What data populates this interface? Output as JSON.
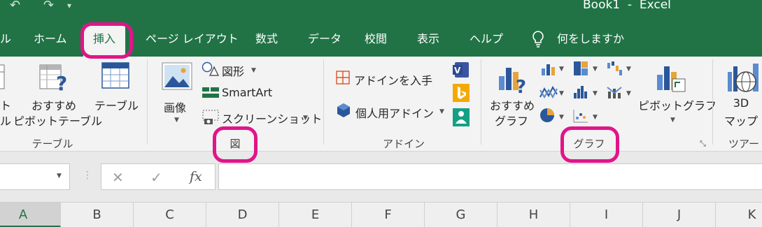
{
  "titlebar": {
    "title": "Book1  -  Excel",
    "undo_icon": "↶",
    "redo_icon": "↷",
    "qat_more_icon": "▾"
  },
  "tabs": [
    {
      "label": "ル"
    },
    {
      "label": "ホーム"
    },
    {
      "label": "挿入"
    },
    {
      "label": "ページ レイアウト"
    },
    {
      "label": "数式"
    },
    {
      "label": "データ"
    },
    {
      "label": "校閲"
    },
    {
      "label": "表示"
    },
    {
      "label": "ヘルプ"
    },
    {
      "label": "何をしますか"
    }
  ],
  "ribbon": {
    "tables": {
      "partial_label_1": "ト",
      "partial_label_2": "ル",
      "recommended_pivot_line1": "おすすめ",
      "recommended_pivot_line2": "ピボットテーブル",
      "table": "テーブル",
      "group": "テーブル"
    },
    "illustrations": {
      "pictures": "画像",
      "shapes": "図形",
      "smartart": "SmartArt",
      "screenshot": "スクリーンショット",
      "group": "図"
    },
    "addins": {
      "get_addins": "アドインを入手",
      "my_addins": "個人用アドイン",
      "group": "アドイン"
    },
    "charts": {
      "recommended_line1": "おすすめ",
      "recommended_line2": "グラフ",
      "pivot_chart": "ピボットグラフ",
      "group": "グラフ"
    },
    "tours": {
      "map3d_line1": "3D",
      "map3d_line2": "マップ",
      "group": "ツアー"
    }
  },
  "formula_bar": {
    "cancel": "✕",
    "enter": "✓",
    "fx": "fx",
    "value": ""
  },
  "columns": [
    "A",
    "B",
    "C",
    "D",
    "E",
    "F",
    "G",
    "H",
    "I",
    "J",
    "K"
  ],
  "colors": {
    "excel_green": "#217346",
    "highlight": "#e0158a"
  }
}
